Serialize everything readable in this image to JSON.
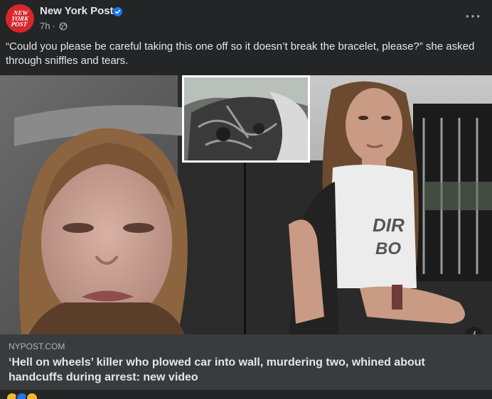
{
  "post": {
    "page_name": "New York Post",
    "avatar_text": [
      "NEW",
      "YORK",
      "POST"
    ],
    "timestamp": "7h",
    "separator": "·",
    "more_label": "···",
    "caption": "“Could you please be careful taking this one off so it doesn’t break the bracelet, please?” she asked through sniffles and tears."
  },
  "link_preview": {
    "domain": "NYPOST.COM",
    "title": "‘Hell on wheels’ killer who plowed car into wall, murdering two, whined about handcuffs during arrest: new video",
    "info_label": "i"
  },
  "colors": {
    "background": "#242526",
    "link_preview_bg": "#3a3b3c",
    "brand_red": "#d9262c",
    "verified_blue": "#1877f2",
    "text_primary": "#e4e6eb",
    "text_secondary": "#b0b3b8"
  },
  "icons": {
    "verified": "verified-badge-icon",
    "audience": "globe-icon",
    "info": "info-icon",
    "reactions": [
      "haha-reaction-icon",
      "like-reaction-icon",
      "sad-reaction-icon"
    ]
  }
}
